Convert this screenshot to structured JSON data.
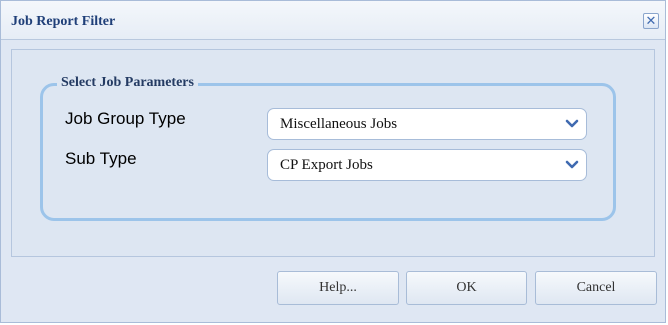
{
  "window": {
    "title": "Job Report Filter",
    "close_label": "✕"
  },
  "form": {
    "section_title": "Select Job Parameters",
    "job_group_type": {
      "label": "Job Group Type",
      "value": "Miscellaneous Jobs"
    },
    "sub_type": {
      "label": "Sub Type",
      "value": "CP Export Jobs"
    }
  },
  "buttons": {
    "help": "Help...",
    "ok": "OK",
    "cancel": "Cancel"
  },
  "icons": {
    "close": "close-icon",
    "dropdown": "chevron-down-icon"
  },
  "colors": {
    "title_text": "#1f3f78",
    "fieldset_border": "#9cc4ea",
    "dialog_bg": "#dfe7f3",
    "chevron": "#3f6ab0"
  }
}
